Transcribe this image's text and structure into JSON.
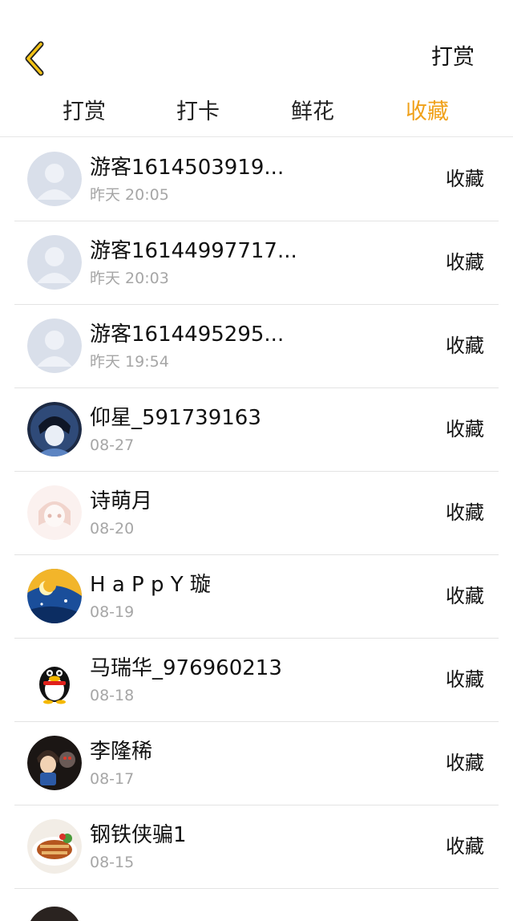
{
  "header": {
    "back_icon": "chevron-left-icon",
    "accent_color": "#f0a11a",
    "action_label": "打赏"
  },
  "tabs": [
    {
      "label": "打赏",
      "active": false
    },
    {
      "label": "打卡",
      "active": false
    },
    {
      "label": "鲜花",
      "active": false
    },
    {
      "label": "收藏",
      "active": true
    }
  ],
  "list": {
    "items": [
      {
        "name": "游客1614503919...",
        "time": "昨天 20:05",
        "action": "收藏",
        "avatar": "default-avatar"
      },
      {
        "name": "游客16144997717...",
        "time": "昨天 20:03",
        "action": "收藏",
        "avatar": "default-avatar"
      },
      {
        "name": "游客1614495295...",
        "time": "昨天 19:54",
        "action": "收藏",
        "avatar": "default-avatar"
      },
      {
        "name": "仰星_591739163",
        "time": "08-27",
        "action": "收藏",
        "avatar": "anime-avatar"
      },
      {
        "name": "诗萌月",
        "time": "08-20",
        "action": "收藏",
        "avatar": "faded-anime-avatar"
      },
      {
        "name": "H a P p Y 璇",
        "time": "08-19",
        "action": "收藏",
        "avatar": "night-art-avatar"
      },
      {
        "name": "马瑞华_976960213",
        "time": "08-18",
        "action": "收藏",
        "avatar": "penguin-avatar"
      },
      {
        "name": "李隆稀",
        "time": "08-17",
        "action": "收藏",
        "avatar": "dark-character-avatar"
      },
      {
        "name": "钢铁侠骗1",
        "time": "08-15",
        "action": "收藏",
        "avatar": "food-avatar"
      }
    ]
  }
}
